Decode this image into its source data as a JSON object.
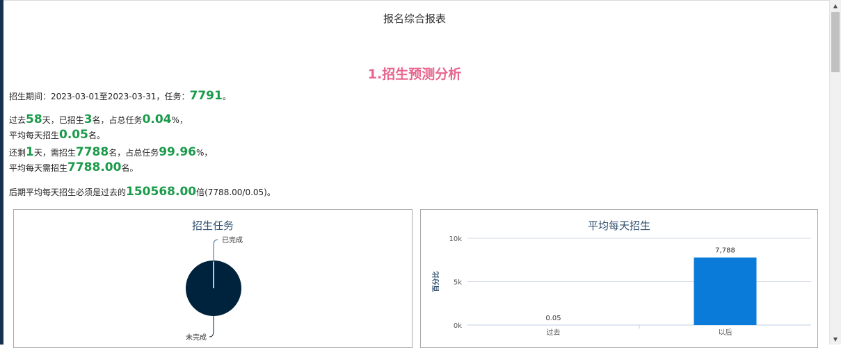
{
  "page": {
    "title": "报名综合报表"
  },
  "section": {
    "heading": "1.招生预测分析"
  },
  "summary": {
    "period_prefix": "招生期间：",
    "period_value": "2023-03-01至2023-03-31，任务：",
    "task": "7791",
    "period_suffix": "。",
    "past_prefix": "过去",
    "past_days": "58",
    "past_mid1": "天，已招生",
    "past_enrolled": "3",
    "past_mid2": "名，占总任务",
    "past_percent": "0.04",
    "past_suffix": "%，",
    "past_avg_prefix": "平均每天招生",
    "past_avg": "0.05",
    "past_avg_suffix": "名。",
    "remain_prefix": "还剩",
    "remain_days": "1",
    "remain_mid1": "天，需招生",
    "remain_needed": "7788",
    "remain_mid2": "名，占总任务",
    "remain_percent": "99.96",
    "remain_suffix": "%，",
    "remain_avg_prefix": "平均每天需招生",
    "remain_avg": "7788.00",
    "remain_avg_suffix": "名。",
    "ratio_prefix": "后期平均每天招生必须是过去的",
    "ratio": "150568.00",
    "ratio_suffix": "倍(7788.00/0.05)。"
  },
  "charts": {
    "pie_title": "招生任务",
    "bar_title": "平均每天招生"
  },
  "colors": {
    "heading": "#e8668f",
    "highlight": "#1a9a4a",
    "pie_incomplete": "#00233d",
    "bar": "#0a7bd8"
  },
  "scrollbar": {
    "up_icon": "▲",
    "down_icon": "▼"
  },
  "chart_data": [
    {
      "type": "pie",
      "title": "招生任务",
      "categories": [
        "已完成",
        "未完成"
      ],
      "values": [
        3,
        7788
      ]
    },
    {
      "type": "bar",
      "title": "平均每天招生",
      "categories": [
        "过去",
        "以后"
      ],
      "values": [
        0.05,
        7788
      ],
      "data_labels": [
        "0.05",
        "7,788"
      ],
      "ylabel": "百分比",
      "ylim": [
        0,
        10000
      ],
      "yticks": [
        0,
        5000,
        10000
      ],
      "ytick_labels": [
        "0k",
        "5k",
        "10k"
      ],
      "grid": true
    }
  ]
}
